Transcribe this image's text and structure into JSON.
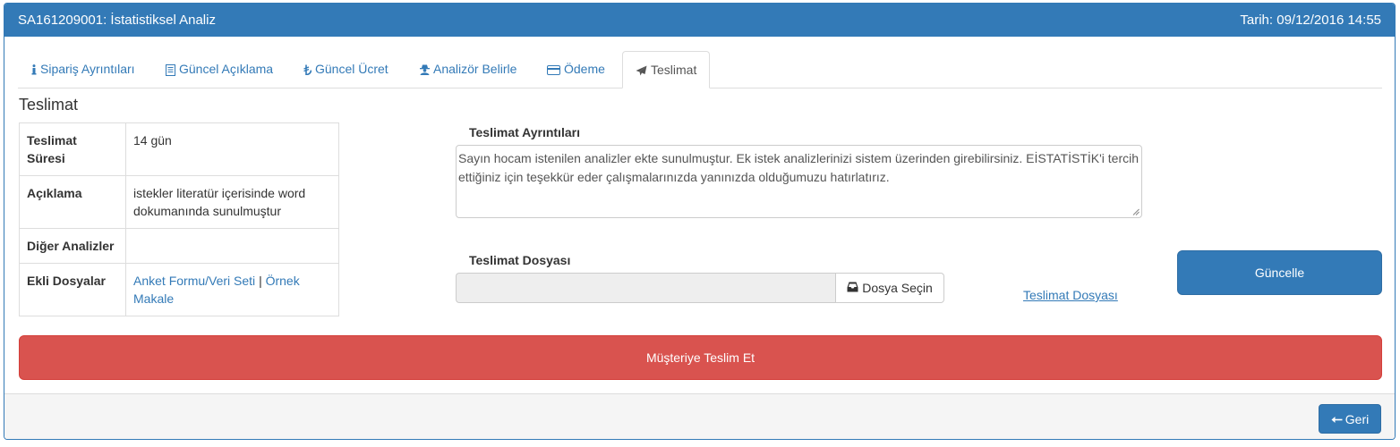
{
  "header": {
    "title": "SA161209001: İstatistiksel Analiz",
    "date": "Tarih: 09/12/2016 14:55"
  },
  "tabs": [
    {
      "label": "Sipariş Ayrıntıları",
      "icon": "info-icon"
    },
    {
      "label": "Güncel Açıklama",
      "icon": "document-icon"
    },
    {
      "label": "Güncel Ücret",
      "icon": "lira-icon"
    },
    {
      "label": "Analizör Belirle",
      "icon": "user-secret-icon"
    },
    {
      "label": "Ödeme",
      "icon": "credit-card-icon"
    },
    {
      "label": "Teslimat",
      "icon": "send-icon",
      "active": true
    }
  ],
  "section_title": "Teslimat",
  "info_table": {
    "rows": [
      {
        "key": "Teslimat Süresi",
        "value": "14 gün"
      },
      {
        "key": "Açıklama",
        "value": "istekler literatür içerisinde word dokumanında sunulmuştur"
      },
      {
        "key": "Diğer Analizler",
        "value": ""
      },
      {
        "key": "Ekli Dosyalar",
        "links": [
          "Anket Formu/Veri Seti",
          "Örnek Makale"
        ],
        "separator": "|"
      }
    ]
  },
  "delivery": {
    "details_label": "Teslimat Ayrıntıları",
    "details_text": "Sayın hocam istenilen analizler ekte sunulmuştur. Ek istek analizlerinizi sistem üzerinden girebilirsiniz. EİSTATİSTİK'i tercih ettiğiniz için teşekkür eder çalışmalarınızda yanınızda olduğumuzu hatırlatırız.",
    "file_label": "Teslimat Dosyası",
    "file_button": "Dosya Seçin",
    "file_link": "Teslimat Dosyası",
    "update_button": "Güncelle"
  },
  "deliver_button": "Müşteriye Teslim Et",
  "footer": {
    "back_button": "Geri"
  },
  "colors": {
    "primary": "#337ab7",
    "danger": "#d9534f",
    "footer_bg": "#f5f5f5"
  }
}
